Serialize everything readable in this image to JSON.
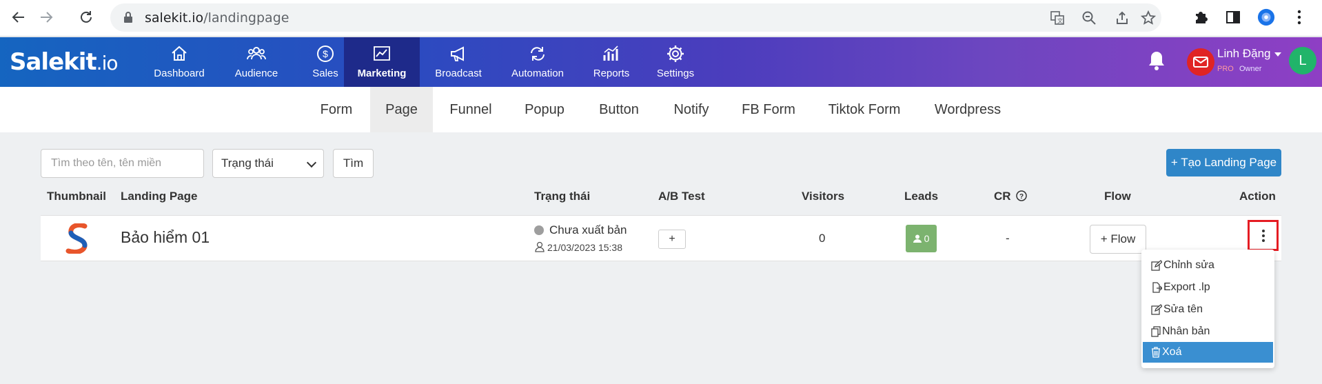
{
  "browser": {
    "url_domain": "salekit.io",
    "url_path": "/landingpage"
  },
  "app": {
    "logo_main": "Salekit",
    "logo_suffix": ".io",
    "nav": [
      {
        "label": "Dashboard",
        "icon": "home-icon"
      },
      {
        "label": "Audience",
        "icon": "users-icon"
      },
      {
        "label": "Sales",
        "icon": "dollar-icon"
      },
      {
        "label": "Marketing",
        "icon": "chart-icon",
        "active": true
      },
      {
        "label": "Broadcast",
        "icon": "megaphone-icon"
      },
      {
        "label": "Automation",
        "icon": "repeat-icon"
      },
      {
        "label": "Reports",
        "icon": "report-icon"
      },
      {
        "label": "Settings",
        "icon": "gear-icon"
      }
    ],
    "user": {
      "name": "Linh Đặng",
      "plan": "PRO",
      "role": "Owner",
      "avatar_letter": "L"
    }
  },
  "subtabs": [
    "Form",
    "Page",
    "Funnel",
    "Popup",
    "Button",
    "Notify",
    "FB Form",
    "Tiktok Form",
    "Wordpress"
  ],
  "toolbar": {
    "search_placeholder": "Tìm theo tên, tên miền",
    "status_selected": "Trạng thái",
    "search_label": "Tìm",
    "create_label": "+ Tạo Landing Page"
  },
  "table": {
    "headers": {
      "thumbnail": "Thumbnail",
      "landing_page": "Landing Page",
      "status": "Trạng thái",
      "ab_test": "A/B Test",
      "visitors": "Visitors",
      "leads": "Leads",
      "cr": "CR",
      "flow": "Flow",
      "action": "Action"
    },
    "rows": [
      {
        "name": "Bảo hiểm 01",
        "status": "Chưa xuất bản",
        "date": "21/03/2023 15:38",
        "ab_label": "+",
        "visitors": "0",
        "leads": "0",
        "cr": "-",
        "flow_label": "+ Flow"
      }
    ]
  },
  "action_menu": [
    {
      "label": "Chỉnh sửa",
      "icon": "edit-icon"
    },
    {
      "label": "Export .lp",
      "icon": "export-icon"
    },
    {
      "label": "Sửa tên",
      "icon": "rename-icon"
    },
    {
      "label": "Nhân bản",
      "icon": "copy-icon"
    },
    {
      "label": "Xoá",
      "icon": "trash-icon",
      "highlighted": true
    }
  ],
  "colors": {
    "header_start": "#1565c0",
    "header_end": "#8e3fc4",
    "primary_button": "#2f86c8",
    "leads_badge": "#7cb36f",
    "highlight": "#e51c23"
  }
}
